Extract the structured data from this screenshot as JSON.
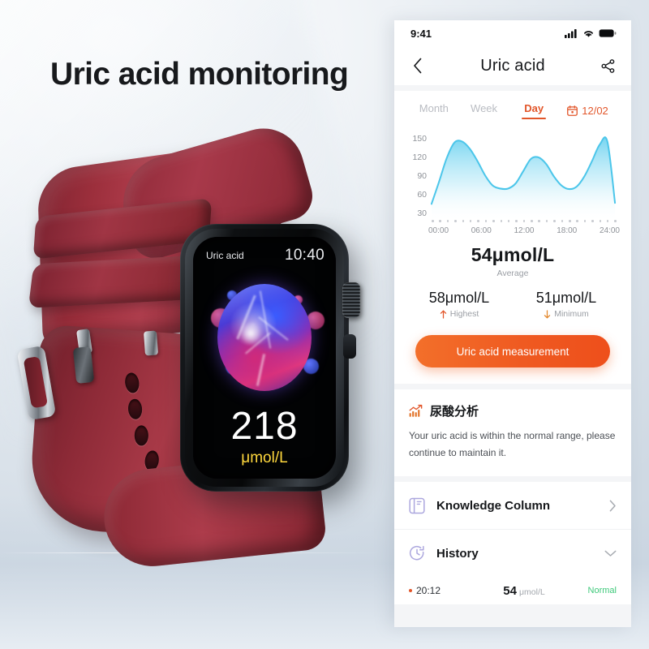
{
  "poster": {
    "headline": "Uric acid monitoring",
    "background_color": "#dfe6ed",
    "band_color": "#8d2a37",
    "case_color": "#0b0d0f"
  },
  "watch": {
    "label": "Uric acid",
    "time": "10:40",
    "value": "218",
    "unit": "μmol/L",
    "value_color": "#ffffff",
    "unit_color": "#ffd83d"
  },
  "phone": {
    "status_bar": {
      "time": "9:41",
      "cellular_icon": "cellular-icon",
      "wifi_icon": "wifi-icon",
      "battery_icon": "battery-icon"
    },
    "navbar": {
      "back_icon": "chevron-left-icon",
      "title": "Uric acid",
      "share_icon": "share-icon"
    },
    "tabs": {
      "items": [
        {
          "label": "Month",
          "active": false
        },
        {
          "label": "Week",
          "active": false
        },
        {
          "label": "Day",
          "active": true
        }
      ],
      "date": "12/02",
      "calendar_icon": "calendar-icon",
      "accent_color": "#e2562a"
    },
    "stats": {
      "average_value": "54μmol/L",
      "average_label": "Average",
      "highest_value": "58μmol/L",
      "highest_label": "Highest",
      "highest_icon": "arrow-up-icon",
      "minimum_value": "51μmol/L",
      "minimum_label": "Minimum",
      "minimum_icon": "arrow-down-icon"
    },
    "cta_button": {
      "label": "Uric acid measurement",
      "color": "#ef5a21"
    },
    "analysis": {
      "icon": "trend-chart-icon",
      "title": "尿酸分析",
      "text": "Your uric acid is within the normal range, please continue to maintain it."
    },
    "list_rows": [
      {
        "label": "Knowledge Column",
        "icon": "book-icon",
        "chevron": "chevron-right-icon"
      },
      {
        "label": "History",
        "icon": "clock-history-icon",
        "chevron": "chevron-down-icon"
      }
    ],
    "history_entry": {
      "time": "20:12",
      "value": "54",
      "unit": "μmol/L",
      "status": "Normal",
      "status_color": "#3ec97a"
    }
  },
  "chart_data": {
    "type": "area",
    "title": "",
    "xlabel": "",
    "ylabel": "",
    "line_color": "#4cc6ea",
    "fill_color": "#8fdcf3",
    "grid": false,
    "legend_position": "none",
    "ylim": [
      0,
      165
    ],
    "yticks": [
      30,
      60,
      90,
      120,
      150
    ],
    "xticks": [
      "00:00",
      "06:00",
      "12:00",
      "18:00",
      "24:00"
    ],
    "xlim": [
      0,
      24
    ],
    "x": [
      0,
      1,
      2,
      3,
      4,
      5,
      6,
      7,
      8,
      9,
      10,
      11,
      12,
      13,
      14,
      15,
      16,
      17,
      18,
      19,
      20,
      21,
      22,
      23,
      24
    ],
    "values": [
      28,
      72,
      118,
      148,
      150,
      136,
      112,
      84,
      64,
      58,
      58,
      68,
      92,
      116,
      119,
      106,
      82,
      64,
      57,
      62,
      82,
      112,
      144,
      150,
      30
    ],
    "axis_dot_count": 25
  }
}
